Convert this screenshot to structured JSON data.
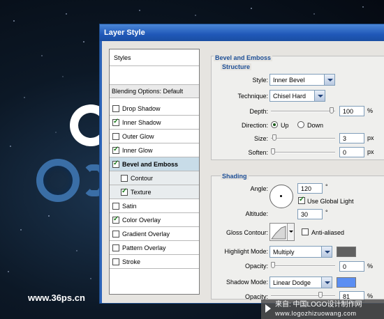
{
  "watermark": "www.36ps.cn",
  "credit": {
    "line1": "来自: 中国LOGO设计制作网",
    "line2": "www.logozhizuowang.com"
  },
  "dialog": {
    "title": "Layer Style"
  },
  "styles_panel": {
    "header": "Styles",
    "blending_options": "Blending Options: Default",
    "items": [
      {
        "label": "Drop Shadow",
        "checked": false
      },
      {
        "label": "Inner Shadow",
        "checked": true
      },
      {
        "label": "Outer Glow",
        "checked": false
      },
      {
        "label": "Inner Glow",
        "checked": true
      },
      {
        "label": "Bevel and Emboss",
        "checked": true
      },
      {
        "label": "Contour",
        "checked": false
      },
      {
        "label": "Texture",
        "checked": true
      },
      {
        "label": "Satin",
        "checked": false
      },
      {
        "label": "Color Overlay",
        "checked": true
      },
      {
        "label": "Gradient Overlay",
        "checked": false
      },
      {
        "label": "Pattern Overlay",
        "checked": false
      },
      {
        "label": "Stroke",
        "checked": false
      }
    ]
  },
  "bevel": {
    "title": "Bevel and Emboss",
    "structure_title": "Structure",
    "style_label": "Style:",
    "style_value": "Inner Bevel",
    "technique_label": "Technique:",
    "technique_value": "Chisel Hard",
    "depth_label": "Depth:",
    "depth_value": "100",
    "depth_unit": "%",
    "depth_level": 1.0,
    "direction_label": "Direction:",
    "direction_up": "Up",
    "direction_down": "Down",
    "direction_selected": "Up",
    "size_label": "Size:",
    "size_value": "3",
    "size_unit": "px",
    "size_level": 0.02,
    "soften_label": "Soften:",
    "soften_value": "0",
    "soften_unit": "px",
    "soften_level": 0.0
  },
  "shading": {
    "title": "Shading",
    "angle_label": "Angle:",
    "angle_value": "120",
    "angle_unit": "°",
    "altitude_label": "Altitude:",
    "altitude_value": "30",
    "altitude_unit": "°",
    "global_light_label": "Use Global Light",
    "global_light_checked": true,
    "gloss_label": "Gloss Contour:",
    "anti_aliased_label": "Anti-aliased",
    "anti_aliased_checked": false,
    "highlight_label": "Highlight Mode:",
    "highlight_value": "Multiply",
    "highlight_color": "#606060",
    "highlight_opacity_label": "Opacity:",
    "highlight_opacity": "0",
    "highlight_opacity_unit": "%",
    "highlight_opacity_level": 0.0,
    "shadow_label": "Shadow Mode:",
    "shadow_value": "Linear Dodge",
    "shadow_color": "#5b8ef2",
    "shadow_opacity_label": "Opacity:",
    "shadow_opacity": "81",
    "shadow_opacity_unit": "%",
    "shadow_opacity_level": 0.81
  }
}
